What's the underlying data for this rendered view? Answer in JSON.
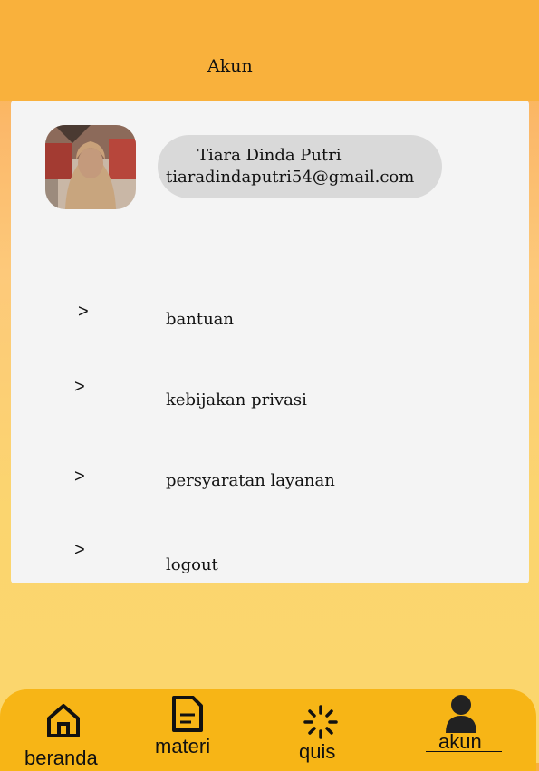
{
  "header": {
    "title": "Akun"
  },
  "profile": {
    "name": "Tiara Dinda Putri",
    "email": "tiaradindaputri54@gmail.com"
  },
  "menu": [
    {
      "chevron": ">",
      "label": "bantuan"
    },
    {
      "chevron": ">",
      "label": "kebijakan privasi"
    },
    {
      "chevron": ">",
      "label": "persyaratan layanan"
    },
    {
      "chevron": ">",
      "label": "logout"
    }
  ],
  "nav": [
    {
      "label": "beranda",
      "icon": "home-icon"
    },
    {
      "label": "materi",
      "icon": "document-icon"
    },
    {
      "label": "quis",
      "icon": "loading-icon"
    },
    {
      "label": "akun",
      "icon": "user-icon",
      "active": true
    }
  ],
  "colors": {
    "header": "#f9b13c",
    "card": "#f4f4f4",
    "pill": "#d9d9d9",
    "nav": "#f7b516"
  }
}
